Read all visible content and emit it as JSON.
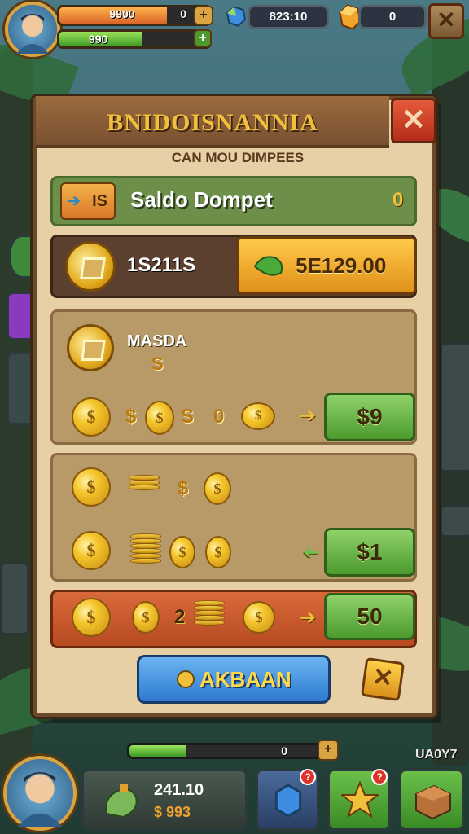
{
  "hud": {
    "bar1_value": "9900",
    "bar1_right": "0",
    "bar2_value": "990",
    "gem_count": "823:10",
    "resource_count": "0",
    "bar1_fill": 0.72,
    "bar2_fill": 0.55
  },
  "panel": {
    "title": "BNIDOISNANNIA",
    "subtitle": "CAN MOU DIMPEES",
    "wallet_tag": "IS",
    "wallet_label": "Saldo Dompet",
    "wallet_value": "0",
    "balance_amount": "1S211S",
    "balance_button": "5E129.00",
    "masda_label": "MASDA",
    "masda_symbol": "S",
    "rows": [
      {
        "items": [
          "$",
          "S",
          "0"
        ],
        "price": "$9"
      },
      {
        "items": [
          "$"
        ],
        "price": "$1"
      },
      {
        "items": [
          "2"
        ],
        "price": "50"
      }
    ],
    "action_button": "AKBAAN"
  },
  "bottom": {
    "progress_value": "0",
    "progress_fill": 0.3,
    "side_text": "UA0Y7",
    "stats_top": "241.10",
    "stats_bottom": "$ 993",
    "badge1": "?",
    "badge2": "?"
  }
}
